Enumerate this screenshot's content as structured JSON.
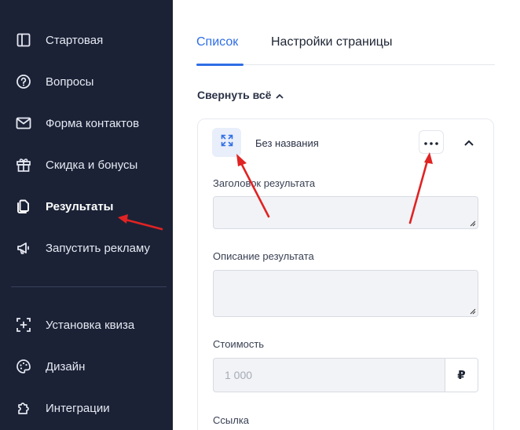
{
  "sidebar": {
    "items": [
      {
        "label": "Стартовая",
        "icon": "layout-panel-icon"
      },
      {
        "label": "Вопросы",
        "icon": "question-circle-icon"
      },
      {
        "label": "Форма контактов",
        "icon": "mail-icon"
      },
      {
        "label": "Скидка и бонусы",
        "icon": "gift-icon"
      },
      {
        "label": "Результаты",
        "icon": "results-pages-icon",
        "active": true
      },
      {
        "label": "Запустить рекламу",
        "icon": "megaphone-icon"
      },
      {
        "label": "Установка квиза",
        "icon": "install-plus-icon"
      },
      {
        "label": "Дизайн",
        "icon": "palette-icon"
      },
      {
        "label": "Интеграции",
        "icon": "puzzle-icon"
      }
    ]
  },
  "tabs": {
    "list_label": "Список",
    "settings_label": "Настройки страницы"
  },
  "collapse_all_label": "Свернуть всё",
  "card": {
    "title": "Без названия",
    "expand_icon": "expand-arrows-icon",
    "more_icon": "more-dots-icon",
    "collapse_icon": "chevron-up-icon"
  },
  "fields": {
    "result_title_label": "Заголовок результата",
    "result_description_label": "Описание результата",
    "price_label": "Стоимость",
    "price_placeholder": "1 000",
    "currency_symbol": "₽",
    "link_label": "Ссылка"
  },
  "colors": {
    "sidebar_bg": "#1b2236",
    "accent": "#2f6ee6",
    "annotation_arrow": "#e02323"
  }
}
